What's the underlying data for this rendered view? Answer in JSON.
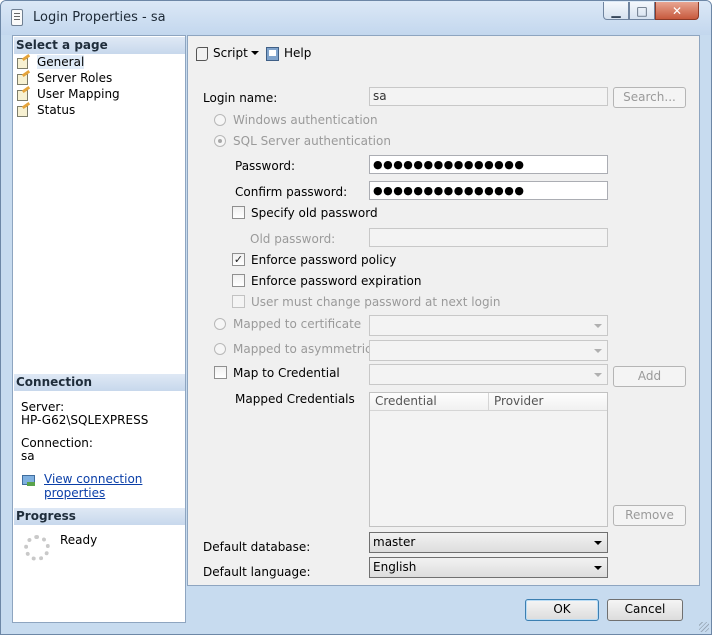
{
  "window": {
    "title": "Login Properties - sa"
  },
  "left": {
    "select_page_heading": "Select a page",
    "pages": [
      "General",
      "Server Roles",
      "User Mapping",
      "Status"
    ],
    "connection_heading": "Connection",
    "server_label": "Server:",
    "server_value": "HP-G62\\SQLEXPRESS",
    "connection_label": "Connection:",
    "connection_value": "sa",
    "view_link": "View connection properties",
    "progress_heading": "Progress",
    "progress_status": "Ready"
  },
  "toolbar": {
    "script": "Script",
    "help": "Help"
  },
  "form": {
    "login_name_label": "Login name:",
    "login_name_value": "sa",
    "search_button": "Search...",
    "windows_auth": "Windows authentication",
    "sql_auth": "SQL Server authentication",
    "password_label": "Password:",
    "password_value": "●●●●●●●●●●●●●●●",
    "confirm_label": "Confirm password:",
    "confirm_value": "●●●●●●●●●●●●●●●",
    "specify_old": "Specify old password",
    "old_password_label": "Old password:",
    "enforce_policy": "Enforce password policy",
    "enforce_expiration": "Enforce password expiration",
    "must_change": "User must change password at next login",
    "mapped_cert": "Mapped to certificate",
    "mapped_asym": "Mapped to asymmetric key",
    "map_credential": "Map to Credential",
    "add_button": "Add",
    "mapped_credentials_label": "Mapped Credentials",
    "grid_columns": [
      "Credential",
      "Provider"
    ],
    "remove_button": "Remove",
    "default_db_label": "Default database:",
    "default_db_value": "master",
    "default_lang_label": "Default language:",
    "default_lang_value": "English"
  },
  "buttons": {
    "ok": "OK",
    "cancel": "Cancel"
  }
}
